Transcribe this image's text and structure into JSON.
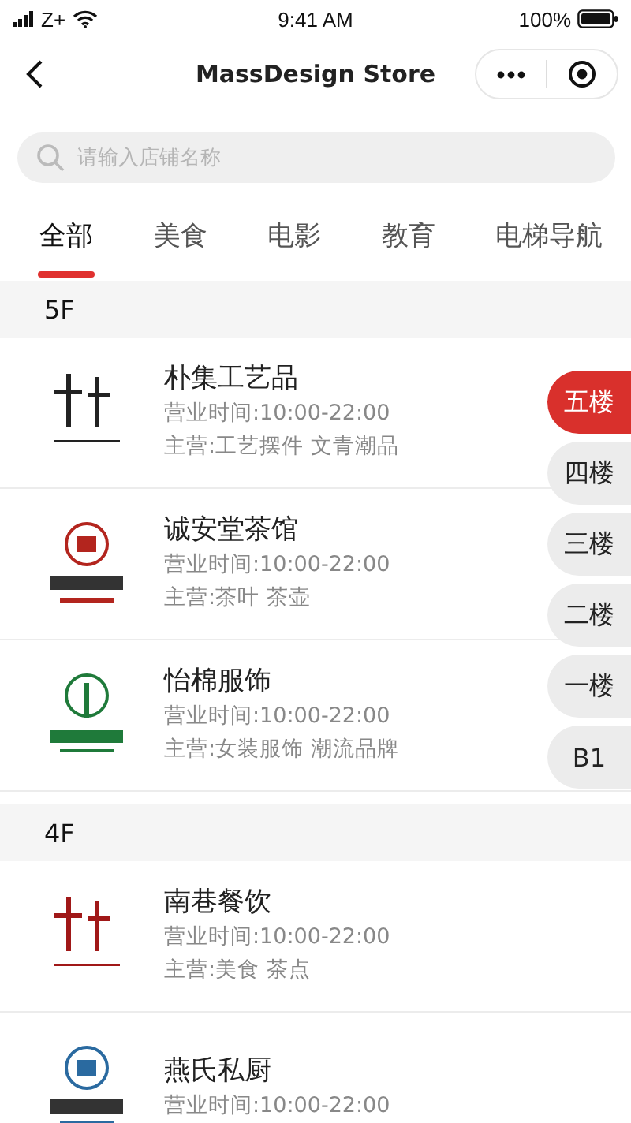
{
  "status_bar": {
    "carrier": "Z+",
    "time": "9:41 AM",
    "battery": "100%"
  },
  "nav": {
    "title": "MassDesign Store"
  },
  "search": {
    "placeholder": "请输入店铺名称"
  },
  "tabs": [
    {
      "label": "全部",
      "selected": true
    },
    {
      "label": "美食",
      "selected": false
    },
    {
      "label": "电影",
      "selected": false
    },
    {
      "label": "教育",
      "selected": false
    },
    {
      "label": "电梯导航",
      "selected": false
    }
  ],
  "sections": [
    {
      "title": "5F",
      "stores": [
        {
          "name": "朴集工艺品",
          "hours": "营业时间:10:00-22:00",
          "category": "主营:工艺摆件 文青潮品",
          "color": "#222222"
        },
        {
          "name": "诚安堂茶馆",
          "hours": "营业时间:10:00-22:00",
          "category": "主营:茶叶 茶壶",
          "color": "#b3251e"
        },
        {
          "name": "怡棉服饰",
          "hours": "营业时间:10:00-22:00",
          "category": "主营:女装服饰 潮流品牌",
          "color": "#1f7a3a"
        }
      ]
    },
    {
      "title": "4F",
      "stores": [
        {
          "name": "南巷餐饮",
          "hours": "营业时间:10:00-22:00",
          "category": "主营:美食 茶点",
          "color": "#a01818"
        },
        {
          "name": "燕氏私厨",
          "hours": "营业时间:10:00-22:00",
          "color": "#2a6aa0"
        }
      ]
    }
  ],
  "floor_index": [
    {
      "label": "五楼",
      "selected": true
    },
    {
      "label": "四楼",
      "selected": false
    },
    {
      "label": "三楼",
      "selected": false
    },
    {
      "label": "二楼",
      "selected": false
    },
    {
      "label": "一楼",
      "selected": false
    },
    {
      "label": "B1",
      "selected": false
    }
  ]
}
